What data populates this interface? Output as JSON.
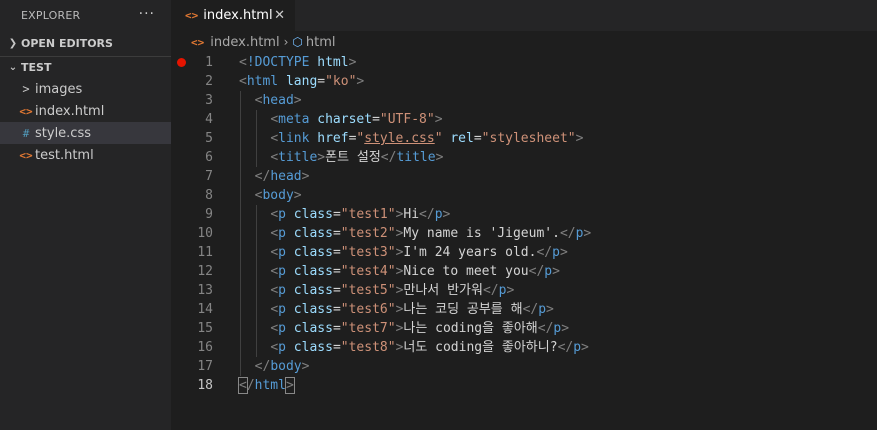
{
  "sidebar": {
    "header": "EXPLORER",
    "more": "···",
    "open_editors": "OPEN EDITORS",
    "folder": "TEST",
    "items": [
      {
        "label": "images",
        "icon": ">",
        "icon_name": "chevron-right-icon"
      },
      {
        "label": "index.html",
        "icon": "<>",
        "icon_name": "html-file-icon"
      },
      {
        "label": "style.css",
        "icon": "#",
        "icon_name": "css-file-icon"
      },
      {
        "label": "test.html",
        "icon": "<>",
        "icon_name": "html-file-icon"
      }
    ]
  },
  "tab": {
    "label": "index.html",
    "close": "✕"
  },
  "breadcrumb": {
    "file": "index.html",
    "symbol": "html"
  },
  "lines": [
    {
      "n": "1",
      "tokens": [
        [
          "br",
          "<"
        ],
        [
          "tag",
          "!DOCTYPE"
        ],
        [
          "txt",
          " "
        ],
        [
          "attr",
          "html"
        ],
        [
          "br",
          ">"
        ]
      ]
    },
    {
      "n": "2",
      "tokens": [
        [
          "br",
          "<"
        ],
        [
          "tag",
          "html"
        ],
        [
          "txt",
          " "
        ],
        [
          "attr",
          "lang"
        ],
        [
          "txt",
          "="
        ],
        [
          "str",
          "\"ko\""
        ],
        [
          "br",
          ">"
        ]
      ]
    },
    {
      "n": "3",
      "tokens": [
        [
          "txt",
          "  "
        ],
        [
          "br",
          "<"
        ],
        [
          "tag",
          "head"
        ],
        [
          "br",
          ">"
        ]
      ]
    },
    {
      "n": "4",
      "tokens": [
        [
          "txt",
          "    "
        ],
        [
          "br",
          "<"
        ],
        [
          "tag",
          "meta"
        ],
        [
          "txt",
          " "
        ],
        [
          "attr",
          "charset"
        ],
        [
          "txt",
          "="
        ],
        [
          "str",
          "\"UTF-8\""
        ],
        [
          "br",
          ">"
        ]
      ]
    },
    {
      "n": "5",
      "tokens": [
        [
          "txt",
          "    "
        ],
        [
          "br",
          "<"
        ],
        [
          "tag",
          "link"
        ],
        [
          "txt",
          " "
        ],
        [
          "attr",
          "href"
        ],
        [
          "txt",
          "="
        ],
        [
          "str",
          "\""
        ],
        [
          "strlink",
          "style.css"
        ],
        [
          "str",
          "\""
        ],
        [
          "txt",
          " "
        ],
        [
          "attr",
          "rel"
        ],
        [
          "txt",
          "="
        ],
        [
          "str",
          "\"stylesheet\""
        ],
        [
          "br",
          ">"
        ]
      ]
    },
    {
      "n": "6",
      "tokens": [
        [
          "txt",
          "    "
        ],
        [
          "br",
          "<"
        ],
        [
          "tag",
          "title"
        ],
        [
          "br",
          ">"
        ],
        [
          "txt",
          "폰트 설정"
        ],
        [
          "br",
          "</"
        ],
        [
          "tag",
          "title"
        ],
        [
          "br",
          ">"
        ]
      ]
    },
    {
      "n": "7",
      "tokens": [
        [
          "txt",
          "  "
        ],
        [
          "br",
          "</"
        ],
        [
          "tag",
          "head"
        ],
        [
          "br",
          ">"
        ]
      ]
    },
    {
      "n": "8",
      "tokens": [
        [
          "txt",
          "  "
        ],
        [
          "br",
          "<"
        ],
        [
          "tag",
          "body"
        ],
        [
          "br",
          ">"
        ]
      ]
    },
    {
      "n": "9",
      "tokens": [
        [
          "txt",
          "    "
        ],
        [
          "br",
          "<"
        ],
        [
          "tag",
          "p"
        ],
        [
          "txt",
          " "
        ],
        [
          "attr",
          "class"
        ],
        [
          "txt",
          "="
        ],
        [
          "str",
          "\"test1\""
        ],
        [
          "br",
          ">"
        ],
        [
          "txt",
          "Hi"
        ],
        [
          "br",
          "</"
        ],
        [
          "tag",
          "p"
        ],
        [
          "br",
          ">"
        ]
      ]
    },
    {
      "n": "10",
      "tokens": [
        [
          "txt",
          "    "
        ],
        [
          "br",
          "<"
        ],
        [
          "tag",
          "p"
        ],
        [
          "txt",
          " "
        ],
        [
          "attr",
          "class"
        ],
        [
          "txt",
          "="
        ],
        [
          "str",
          "\"test2\""
        ],
        [
          "br",
          ">"
        ],
        [
          "txt",
          "My name is 'Jigeum'."
        ],
        [
          "br",
          "</"
        ],
        [
          "tag",
          "p"
        ],
        [
          "br",
          ">"
        ]
      ]
    },
    {
      "n": "11",
      "tokens": [
        [
          "txt",
          "    "
        ],
        [
          "br",
          "<"
        ],
        [
          "tag",
          "p"
        ],
        [
          "txt",
          " "
        ],
        [
          "attr",
          "class"
        ],
        [
          "txt",
          "="
        ],
        [
          "str",
          "\"test3\""
        ],
        [
          "br",
          ">"
        ],
        [
          "txt",
          "I'm 24 years old."
        ],
        [
          "br",
          "</"
        ],
        [
          "tag",
          "p"
        ],
        [
          "br",
          ">"
        ]
      ]
    },
    {
      "n": "12",
      "tokens": [
        [
          "txt",
          "    "
        ],
        [
          "br",
          "<"
        ],
        [
          "tag",
          "p"
        ],
        [
          "txt",
          " "
        ],
        [
          "attr",
          "class"
        ],
        [
          "txt",
          "="
        ],
        [
          "str",
          "\"test4\""
        ],
        [
          "br",
          ">"
        ],
        [
          "txt",
          "Nice to meet you"
        ],
        [
          "br",
          "</"
        ],
        [
          "tag",
          "p"
        ],
        [
          "br",
          ">"
        ]
      ]
    },
    {
      "n": "13",
      "tokens": [
        [
          "txt",
          "    "
        ],
        [
          "br",
          "<"
        ],
        [
          "tag",
          "p"
        ],
        [
          "txt",
          " "
        ],
        [
          "attr",
          "class"
        ],
        [
          "txt",
          "="
        ],
        [
          "str",
          "\"test5\""
        ],
        [
          "br",
          ">"
        ],
        [
          "txt",
          "만나서 반가워"
        ],
        [
          "br",
          "</"
        ],
        [
          "tag",
          "p"
        ],
        [
          "br",
          ">"
        ]
      ]
    },
    {
      "n": "14",
      "tokens": [
        [
          "txt",
          "    "
        ],
        [
          "br",
          "<"
        ],
        [
          "tag",
          "p"
        ],
        [
          "txt",
          " "
        ],
        [
          "attr",
          "class"
        ],
        [
          "txt",
          "="
        ],
        [
          "str",
          "\"test6\""
        ],
        [
          "br",
          ">"
        ],
        [
          "txt",
          "나는 코딩 공부를 해"
        ],
        [
          "br",
          "</"
        ],
        [
          "tag",
          "p"
        ],
        [
          "br",
          ">"
        ]
      ]
    },
    {
      "n": "15",
      "tokens": [
        [
          "txt",
          "    "
        ],
        [
          "br",
          "<"
        ],
        [
          "tag",
          "p"
        ],
        [
          "txt",
          " "
        ],
        [
          "attr",
          "class"
        ],
        [
          "txt",
          "="
        ],
        [
          "str",
          "\"test7\""
        ],
        [
          "br",
          ">"
        ],
        [
          "txt",
          "나는 coding을 좋아해"
        ],
        [
          "br",
          "</"
        ],
        [
          "tag",
          "p"
        ],
        [
          "br",
          ">"
        ]
      ]
    },
    {
      "n": "16",
      "tokens": [
        [
          "txt",
          "    "
        ],
        [
          "br",
          "<"
        ],
        [
          "tag",
          "p"
        ],
        [
          "txt",
          " "
        ],
        [
          "attr",
          "class"
        ],
        [
          "txt",
          "="
        ],
        [
          "str",
          "\"test8\""
        ],
        [
          "br",
          ">"
        ],
        [
          "txt",
          "너도 coding을 좋아하니?"
        ],
        [
          "br",
          "</"
        ],
        [
          "tag",
          "p"
        ],
        [
          "br",
          ">"
        ]
      ]
    },
    {
      "n": "17",
      "tokens": [
        [
          "txt",
          "  "
        ],
        [
          "br",
          "</"
        ],
        [
          "tag",
          "body"
        ],
        [
          "br",
          ">"
        ]
      ]
    },
    {
      "n": "18",
      "tokens": [
        [
          "brbox",
          "<"
        ],
        [
          "br",
          "/"
        ],
        [
          "tag",
          "html"
        ],
        [
          "brbox",
          ">"
        ]
      ]
    }
  ],
  "breakpoint_line": "1",
  "active_line": "18",
  "colors": {
    "accent_html": "#e37933",
    "accent_css": "#519aba",
    "breakpoint": "#e51400"
  }
}
